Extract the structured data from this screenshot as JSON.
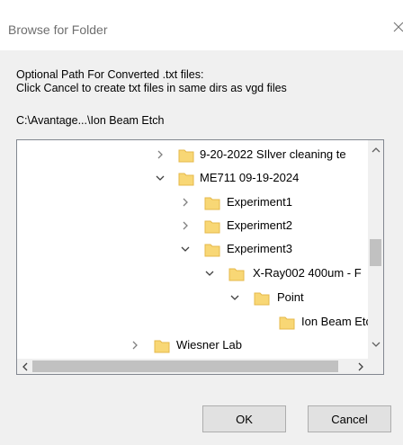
{
  "dialog": {
    "title": "Browse for Folder",
    "description_line1": "Optional Path For Converted .txt files:",
    "description_line2": "Click Cancel to create txt files in same dirs as vgd files",
    "selected_path": "C:\\Avantage...\\Ion Beam Etch"
  },
  "tree": {
    "rows": [
      {
        "label": "9-20-2022 SIlver cleaning te",
        "chevron": "right"
      },
      {
        "label": "ME711 09-19-2024",
        "chevron": "down"
      },
      {
        "label": "Experiment1",
        "chevron": "right"
      },
      {
        "label": "Experiment2",
        "chevron": "right"
      },
      {
        "label": "Experiment3",
        "chevron": "down"
      },
      {
        "label": "X-Ray002 400um - F",
        "chevron": "down"
      },
      {
        "label": "Point",
        "chevron": "down"
      },
      {
        "label": "Ion Beam Etc",
        "chevron": "none"
      },
      {
        "label": "Wiesner Lab",
        "chevron": "right"
      }
    ]
  },
  "buttons": {
    "ok": "OK",
    "cancel": "Cancel"
  },
  "icons": {
    "close": "close-icon",
    "folder": "folder-icon",
    "chevron_right": "chevron-right-icon",
    "chevron_down": "chevron-down-icon",
    "scroll_up": "scroll-up-icon",
    "scroll_down": "scroll-down-icon",
    "scroll_left": "scroll-left-icon",
    "scroll_right": "scroll-right-icon"
  },
  "colors": {
    "folder": "#f8d775",
    "folder_dark": "#e6b84a",
    "chevron": "#808080"
  }
}
